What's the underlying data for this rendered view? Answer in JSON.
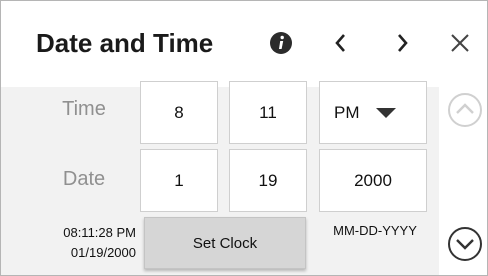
{
  "dialog": {
    "title": "Date and Time",
    "icons": {
      "info": "info-icon",
      "prev": "chevron-left-icon",
      "next": "chevron-right-icon",
      "close": "close-icon",
      "scroll_up": "chevron-up-circle-icon",
      "scroll_down": "chevron-down-circle-icon"
    }
  },
  "time": {
    "label": "Time",
    "hour": "8",
    "minute": "11",
    "ampm": "PM"
  },
  "date": {
    "label": "Date",
    "month": "1",
    "day": "19",
    "year": "2000"
  },
  "status": {
    "current_time": "08:11:28 PM",
    "current_date": "01/19/2000",
    "format": "MM-DD-YYYY"
  },
  "actions": {
    "set_clock": "Set Clock"
  },
  "colors": {
    "panel_bg": "#f2f2f2",
    "label_gray": "#909090",
    "button_bg": "#d6d6d6"
  }
}
